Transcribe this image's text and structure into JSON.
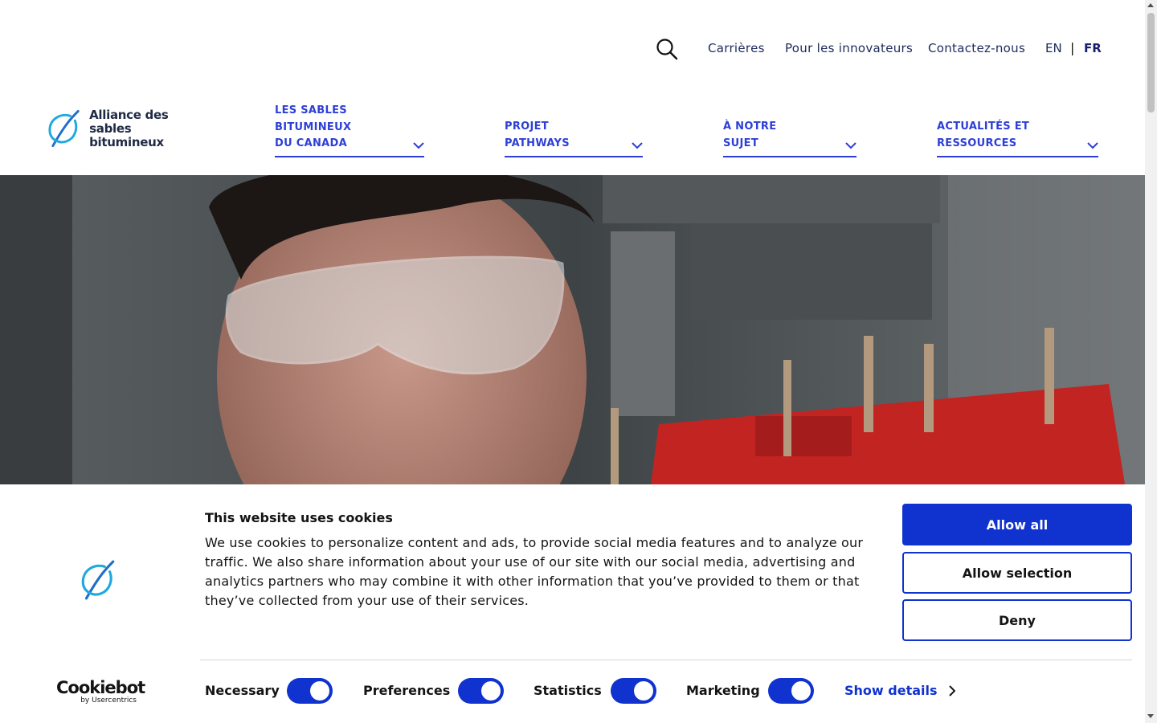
{
  "utility": {
    "links": [
      "Carrières",
      "Pour les innovateurs",
      "Contactez-nous"
    ],
    "lang_en": "EN",
    "lang_sep": "|",
    "lang_fr": "FR"
  },
  "logo": {
    "line1": "Alliance des",
    "line2": "sables bitumineux"
  },
  "nav": [
    {
      "lines": [
        "LES SABLES",
        "BITUMINEUX",
        "DU CANADA"
      ]
    },
    {
      "lines": [
        "PROJET",
        "PATHWAYS"
      ]
    },
    {
      "lines": [
        "À NOTRE",
        "SUJET"
      ]
    },
    {
      "lines": [
        "ACTUALITÉS ET",
        "RESSOURCES"
      ]
    }
  ],
  "cookie": {
    "title": "This website uses cookies",
    "text": "We use cookies to personalize content and ads, to provide social media features and to analyze our traffic. We also share information about your use of our site with our social media, advertising and analytics partners who may combine it with other information that you’ve provided to them or that they’ve collected from your use of their services.",
    "allow_all": "Allow all",
    "allow_selection": "Allow selection",
    "deny": "Deny",
    "toggles": [
      "Necessary",
      "Preferences",
      "Statistics",
      "Marketing"
    ],
    "show_details": "Show details",
    "brand": "Cookiebot",
    "brand_sub": "by Usercentrics"
  },
  "colors": {
    "accent": "#1032cf",
    "nav_blue": "#2d3fd6",
    "logo_cyan": "#1fa8e0"
  }
}
